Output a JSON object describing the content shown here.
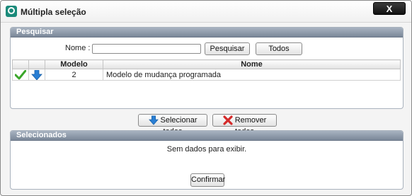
{
  "window": {
    "title": "Múltipla seleção",
    "close_label": "X"
  },
  "search": {
    "header": "Pesquisar",
    "name_label": "Nome :",
    "name_value": "",
    "search_button": "Pesquisar",
    "all_button": "Todos"
  },
  "grid": {
    "columns": [
      "",
      "",
      "Modelo",
      "Nome"
    ],
    "rows": [
      {
        "modelo": "2",
        "nome": "Modelo de mudança programada"
      }
    ]
  },
  "actions": {
    "select_all": "Selecionar todos",
    "remove_all": "Remover todos"
  },
  "selected": {
    "header": "Selecionados",
    "empty_message": "Sem dados para exibir."
  },
  "confirm_button": "Confirmar",
  "colors": {
    "header_bg": "#8a96a6",
    "check": "#3aa62a",
    "arrow": "#2a7fd4",
    "remove": "#d42a2a"
  }
}
